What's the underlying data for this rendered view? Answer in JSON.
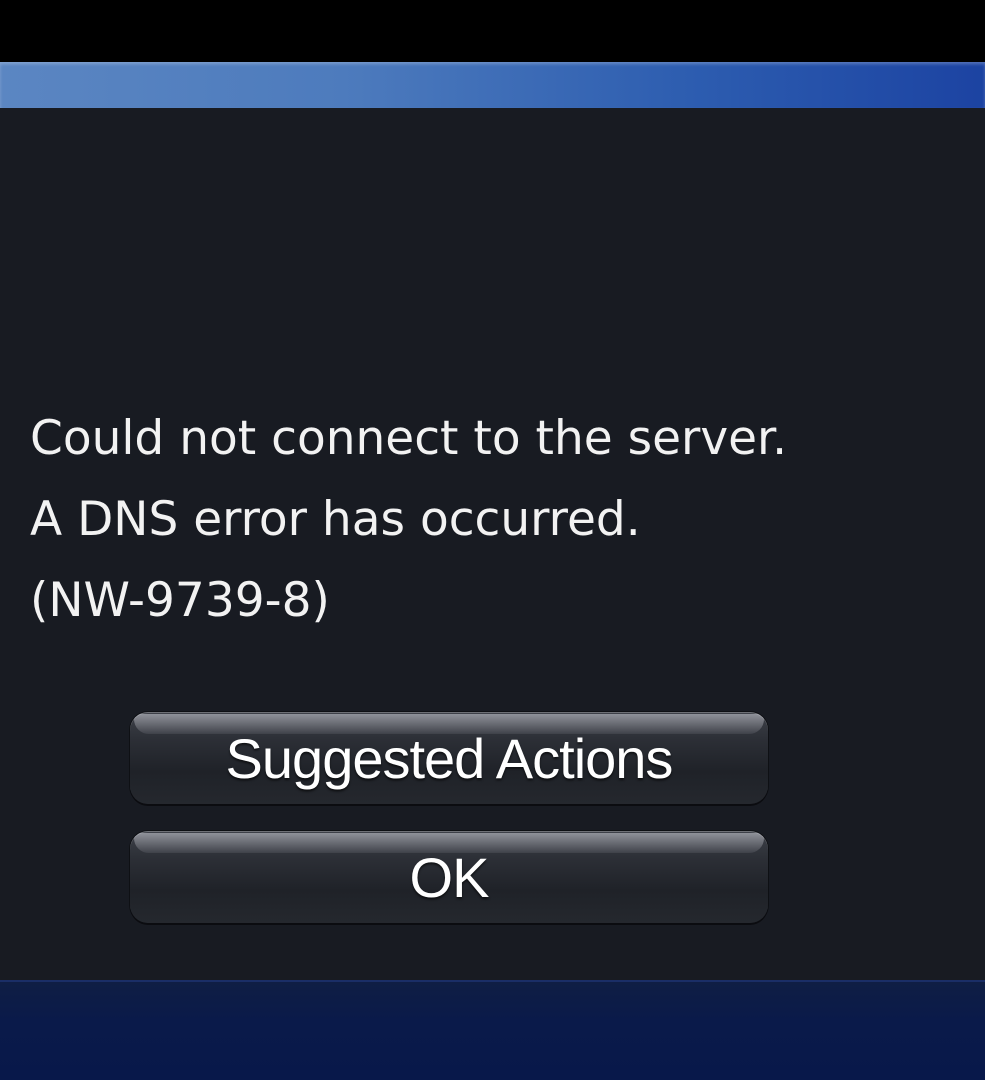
{
  "dialog": {
    "message_lines": [
      "Could not connect to the server.",
      "A DNS error has occurred.",
      "(NW-9739-8)"
    ],
    "buttons": {
      "suggested_actions": "Suggested Actions",
      "ok": "OK"
    }
  },
  "colors": {
    "top_bar": "#4d7bbd",
    "dialog_background": "#181b22",
    "bottom_bar": "#0a1a4a",
    "text": "#f2f2f2"
  }
}
